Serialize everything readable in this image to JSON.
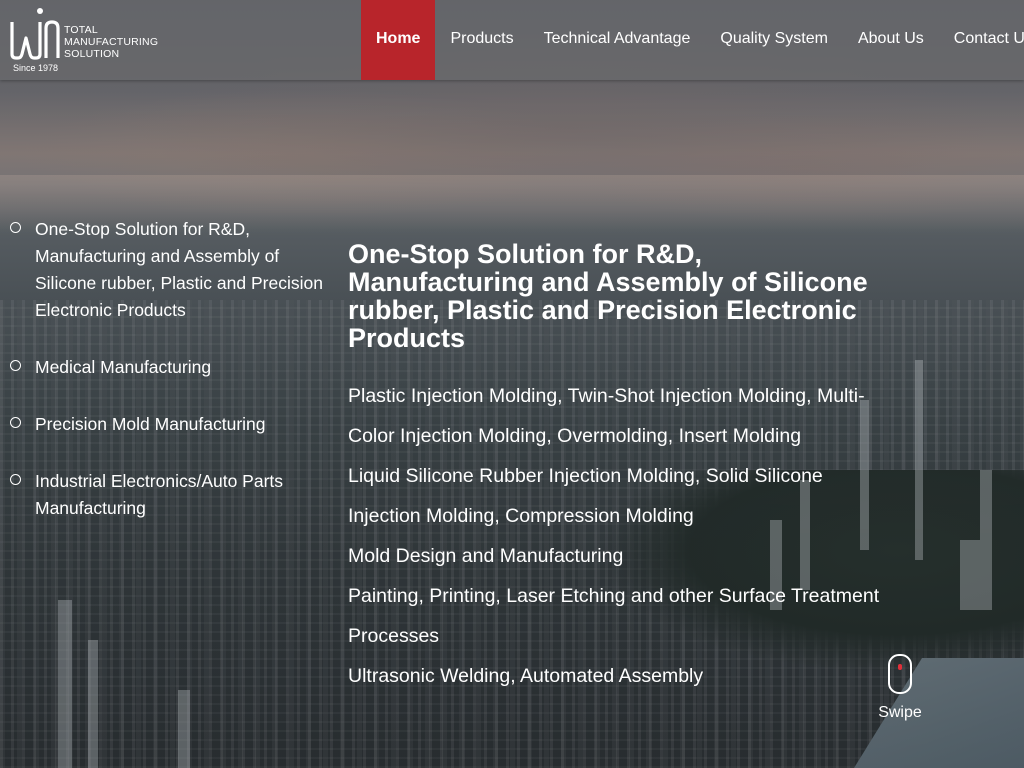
{
  "brand": {
    "logo_mark": "win",
    "logo_lines": [
      "TOTAL",
      "MANUFACTURING",
      "SOLUTION"
    ],
    "since": "Since 1978"
  },
  "nav": {
    "items": [
      {
        "label": "Home",
        "active": true
      },
      {
        "label": "Products",
        "active": false
      },
      {
        "label": "Technical Advantage",
        "active": false
      },
      {
        "label": "Quality System",
        "active": false
      },
      {
        "label": "About Us",
        "active": false
      },
      {
        "label": "Contact Us",
        "active": false
      }
    ],
    "active_color": "#b8252b"
  },
  "sidebar": {
    "items": [
      {
        "label": "One-Stop Solution for R&D, Manufacturing and Assembly of Silicone rubber, Plastic and Precision Electronic Products",
        "icon": "circle-bullet-icon"
      },
      {
        "label": "Medical Manufacturing",
        "icon": "circle-bullet-icon"
      },
      {
        "label": "Precision Mold Manufacturing",
        "icon": "circle-bullet-icon"
      },
      {
        "label": "Industrial Electronics/Auto Parts Manufacturing",
        "icon": "circle-bullet-icon"
      }
    ]
  },
  "main": {
    "title": "One-Stop Solution for R&D, Manufacturing and Assembly of Silicone rubber, Plastic and Precision Electronic Products",
    "services": [
      "Plastic Injection Molding, Twin-Shot Injection Molding, Multi-Color Injection Molding, Overmolding, Insert Molding",
      "Liquid Silicone Rubber Injection Molding, Solid Silicone Injection Molding, Compression Molding",
      "Mold Design and Manufacturing",
      "Painting, Printing, Laser Etching and other Surface Treatment Processes",
      "Ultrasonic Welding, Automated Assembly"
    ]
  },
  "swipe": {
    "label": "Swipe",
    "icon": "mouse-scroll-icon",
    "accent": "#e0303a"
  }
}
